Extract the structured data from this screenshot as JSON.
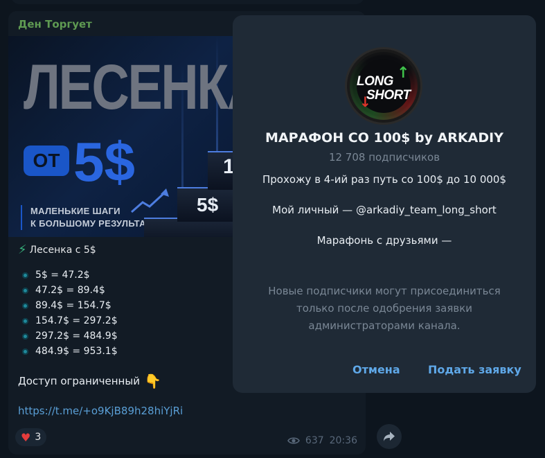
{
  "message": {
    "sender": "Ден Торгует",
    "promo": {
      "title": "ЛЕСЕНКА",
      "ot": "ОТ",
      "price": "5$",
      "tagline_1": "МАЛЕНЬКИЕ ШАГИ",
      "tagline_2": "К БОЛЬШОМУ РЕЗУЛЬТАТУ!",
      "step_1": "5$",
      "step_2": "1"
    },
    "heading": "Лесенка с 5$",
    "steps": [
      "5$ = 47.2$",
      "47.2$ = 89.4$",
      "89.4$ = 154.7$",
      "154.7$ = 297.2$",
      "297.2$ = 484.9$",
      "484.9$ = 953.1$"
    ],
    "access_text": "Доступ ограниченный",
    "link": "https://t.me/+o9KjB89h28hiYjRi",
    "reaction_count": "3",
    "views": "637",
    "time": "20:36"
  },
  "dialog": {
    "avatar_text_1": "LONG",
    "avatar_text_2": "SHORT",
    "title": "МАРАФОН СО 100$ by ARKADIY",
    "subscribers": "12 708 подписчиков",
    "desc_1": "Прохожу в 4-ий раз путь со 100$ до 10 000$",
    "desc_2": "Мой личный — @arkadiy_team_long_short",
    "desc_3": "Марафонь с друзьями —",
    "note": "Новые подписчики могут присоединиться только после одобрения заявки администраторами канала.",
    "cancel_label": "Отмена",
    "apply_label": "Подать заявку"
  }
}
